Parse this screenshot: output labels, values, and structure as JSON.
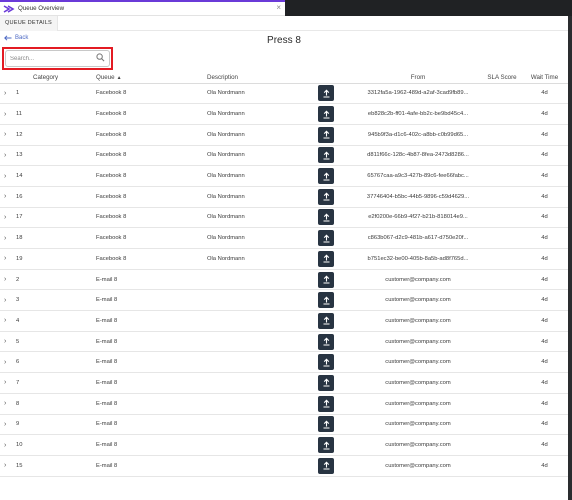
{
  "window": {
    "title": "Queue Overview",
    "close": "×"
  },
  "tabs": [
    {
      "label": "QUEUE DETAILS"
    }
  ],
  "back": {
    "label": "Back"
  },
  "page_title": "Press 8",
  "search": {
    "placeholder": "Search..."
  },
  "columns": {
    "category": "Category",
    "queue": "Queue",
    "description": "Description",
    "from": "From",
    "sla": "SLA Score",
    "wait": "Wait Time"
  },
  "sort": {
    "column": "queue",
    "direction": "asc"
  },
  "colors": {
    "accent": "#6a3ad8",
    "highlight": "#e31b23",
    "action_button": "#283442",
    "link": "#4b68c4"
  },
  "rows": [
    {
      "id": "1",
      "queue": "Facebook 8",
      "description": "Ola Nordmann",
      "from": "3312fa5a-1962-489d-a2af-3cad9fb89...",
      "wait": "4d"
    },
    {
      "id": "11",
      "queue": "Facebook 8",
      "description": "Ola Nordmann",
      "from": "eb828c2b-ff01-4afe-bb2c-be9bd45c4...",
      "wait": "4d"
    },
    {
      "id": "12",
      "queue": "Facebook 8",
      "description": "Ola Nordmann",
      "from": "945b9f3a-d1c6-402c-a8bb-c0b99d65...",
      "wait": "4d"
    },
    {
      "id": "13",
      "queue": "Facebook 8",
      "description": "Ola Nordmann",
      "from": "d811f66c-128c-4b87-8fea-2473d8286...",
      "wait": "4d"
    },
    {
      "id": "14",
      "queue": "Facebook 8",
      "description": "Ola Nordmann",
      "from": "65767caa-a9c3-427b-89c6-fee66fabc...",
      "wait": "4d"
    },
    {
      "id": "16",
      "queue": "Facebook 8",
      "description": "Ola Nordmann",
      "from": "37746404-b5bc-44b5-9896-c59d4629...",
      "wait": "4d"
    },
    {
      "id": "17",
      "queue": "Facebook 8",
      "description": "Ola Nordmann",
      "from": "e2f0200e-66b9-4f27-b21b-818014e9...",
      "wait": "4d"
    },
    {
      "id": "18",
      "queue": "Facebook 8",
      "description": "Ola Nordmann",
      "from": "c863b067-d2c9-481b-a617-d750e20f...",
      "wait": "4d"
    },
    {
      "id": "19",
      "queue": "Facebook 8",
      "description": "Ola Nordmann",
      "from": "b751ec32-be00-405b-8a5b-ad8f765d...",
      "wait": "4d"
    },
    {
      "id": "2",
      "queue": "E-mail 8",
      "description": "",
      "from": "customer@company.com",
      "wait": "4d"
    },
    {
      "id": "3",
      "queue": "E-mail 8",
      "description": "",
      "from": "customer@company.com",
      "wait": "4d"
    },
    {
      "id": "4",
      "queue": "E-mail 8",
      "description": "",
      "from": "customer@company.com",
      "wait": "4d"
    },
    {
      "id": "5",
      "queue": "E-mail 8",
      "description": "",
      "from": "customer@company.com",
      "wait": "4d"
    },
    {
      "id": "6",
      "queue": "E-mail 8",
      "description": "",
      "from": "customer@company.com",
      "wait": "4d"
    },
    {
      "id": "7",
      "queue": "E-mail 8",
      "description": "",
      "from": "customer@company.com",
      "wait": "4d"
    },
    {
      "id": "8",
      "queue": "E-mail 8",
      "description": "",
      "from": "customer@company.com",
      "wait": "4d"
    },
    {
      "id": "9",
      "queue": "E-mail 8",
      "description": "",
      "from": "customer@company.com",
      "wait": "4d"
    },
    {
      "id": "10",
      "queue": "E-mail 8",
      "description": "",
      "from": "customer@company.com",
      "wait": "4d"
    },
    {
      "id": "15",
      "queue": "E-mail 8",
      "description": "",
      "from": "customer@company.com",
      "wait": "4d"
    }
  ]
}
